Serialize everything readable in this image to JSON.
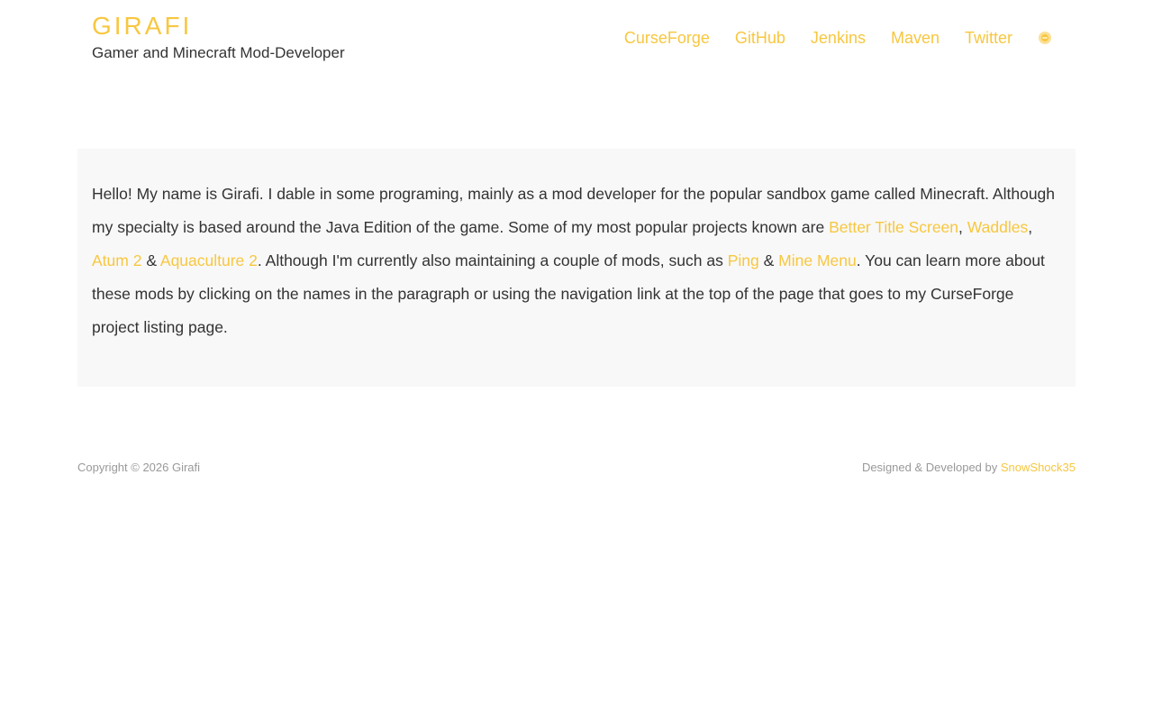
{
  "header": {
    "site_title": "GIRAFI",
    "tagline": "Gamer and Minecraft Mod-Developer"
  },
  "nav": {
    "items": [
      {
        "label": "CurseForge"
      },
      {
        "label": "GitHub"
      },
      {
        "label": "Jenkins"
      },
      {
        "label": "Maven"
      },
      {
        "label": "Twitter"
      }
    ],
    "toggle_icon": "theme-toggle-icon"
  },
  "intro": {
    "part1": "Hello! My name is Girafi. I dable in some programing, mainly as a mod developer for the popular sandbox game called Minecraft. Although my specialty is based around the Java Edition of the game. Some of my most popular projects known are ",
    "link_better_title_screen": "Better Title Screen",
    "sep1": ", ",
    "link_waddles": "Waddles",
    "sep2": ", ",
    "link_atum": "Atum 2",
    "sep3": " & ",
    "link_aquaculture": "Aquaculture 2",
    "part2": ". Although I'm currently also maintaining a couple of mods, such as ",
    "link_ping": "Ping",
    "sep4": " & ",
    "link_mine_menu": "Mine Menu",
    "part3": ". You can learn more about these mods by clicking on the names in the paragraph or using the navigation link at the top of the page that goes to my CurseForge project listing page."
  },
  "footer": {
    "copyright": "Copyright © 2026 Girafi",
    "designed_by": "Designed & Developed by ",
    "designer_link": "SnowShock35"
  },
  "colors": {
    "accent": "#f7c740",
    "text": "#333333",
    "muted": "#999999",
    "panel_bg": "#f8f8f8"
  }
}
